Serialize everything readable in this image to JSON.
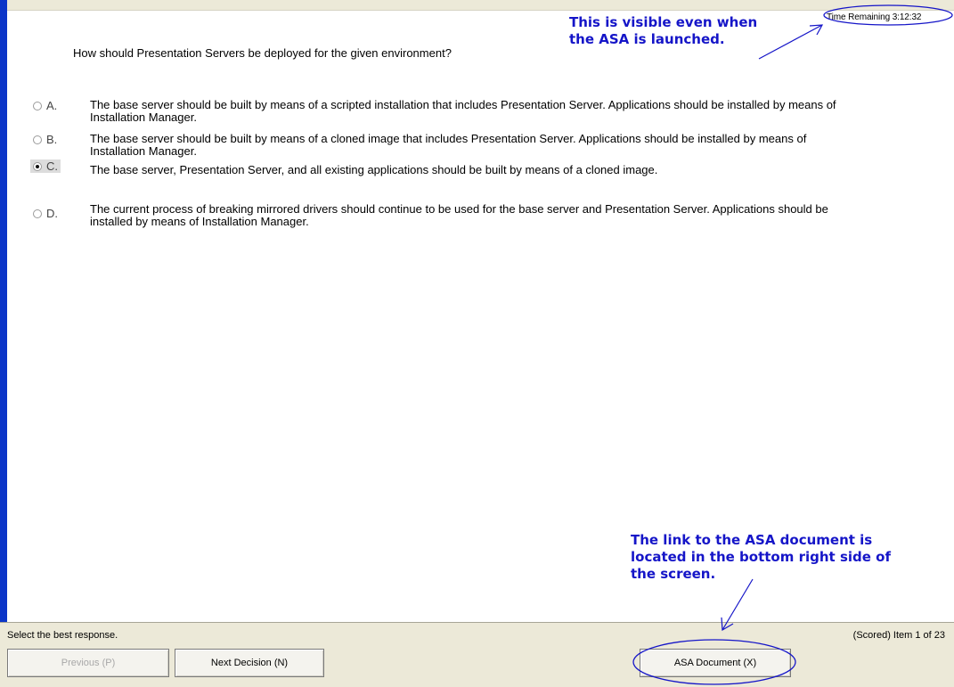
{
  "timer": {
    "label": "Time Remaining 3:12:32"
  },
  "question": {
    "text": "How should Presentation Servers be deployed for the given environment?"
  },
  "options": [
    {
      "letter": "A.",
      "text": "The base server should be built by means of a scripted installation that includes Presentation Server. Applications should be installed by means of Installation Manager.",
      "selected": false
    },
    {
      "letter": "B.",
      "text": "The base server should be built by means of a cloned image that includes Presentation Server. Applications should be installed by means of Installation Manager.",
      "selected": false
    },
    {
      "letter": "C.",
      "text": "The base server, Presentation Server, and all existing applications should be built by means of a cloned image.",
      "selected": true
    },
    {
      "letter": "D.",
      "text": "The current process of breaking mirrored drivers should continue to be used for the base server and Presentation Server. Applications should be installed by means of Installation Manager.",
      "selected": false
    }
  ],
  "annotations": {
    "top": "This is visible even when\nthe ASA is launched.",
    "bottom": "The link to the ASA document is\nlocated in the bottom right side of\nthe screen.",
    "color": "#1515c8"
  },
  "footer": {
    "instruction": "Select the best response.",
    "status": "(Scored)  Item 1 of 23",
    "previous_label": "Previous (P)",
    "next_label": "Next Decision (N)",
    "asa_label": "ASA Document (X)"
  },
  "colors": {
    "accent_blue": "#0b35c8",
    "footer_bg": "#ece9d8"
  }
}
